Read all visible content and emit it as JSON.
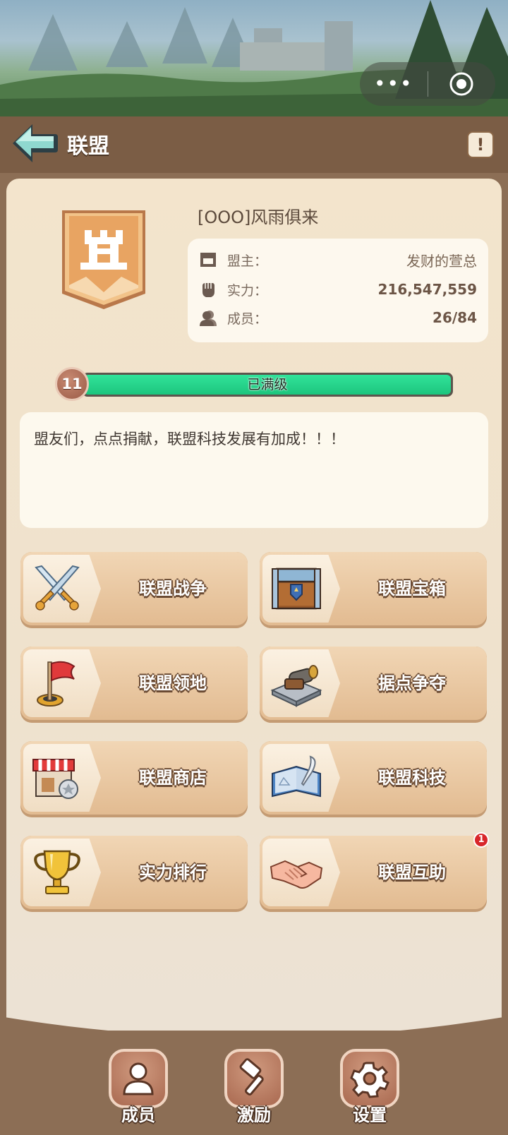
{
  "header": {
    "title": "联盟",
    "capsule_more": "•••"
  },
  "alliance": {
    "name": "[OOO]风雨俱来",
    "leader_label": "盟主：",
    "leader_value": "发财的萱总",
    "power_label": "实力：",
    "power_value": "216,547,559",
    "members_label": "成员：",
    "members_value": "26/84"
  },
  "level": {
    "value": "11",
    "status": "已满级",
    "progress": 1.0
  },
  "notice": {
    "text": "盟友们，点点捐献，联盟科技发展有加成！！！"
  },
  "menu": {
    "war": "联盟战争",
    "chest": "联盟宝箱",
    "territory": "联盟领地",
    "stronghold": "据点争夺",
    "shop": "联盟商店",
    "tech": "联盟科技",
    "ranking": "实力排行",
    "help": "联盟互助",
    "help_badge": "1"
  },
  "bottom_nav": {
    "members": "成员",
    "incentive": "激励",
    "settings": "设置"
  },
  "colors": {
    "accent_green": "#1dc57d",
    "panel_bg": "#f3e4cc",
    "frame_brown": "#8c6e55"
  }
}
